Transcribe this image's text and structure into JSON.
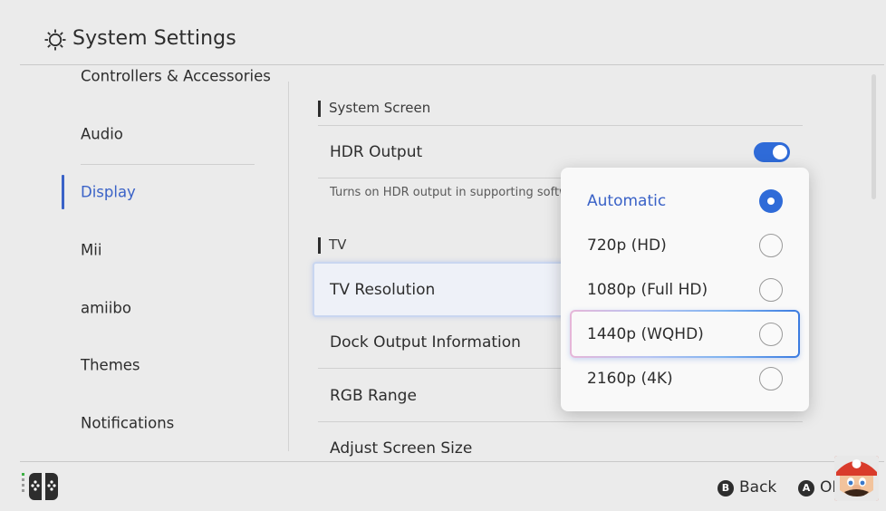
{
  "header": {
    "title": "System Settings",
    "icon": "gear-icon"
  },
  "sidebar": {
    "items": [
      {
        "label": "Controllers & Accessories"
      },
      {
        "label": "Audio"
      },
      {
        "label": "Display",
        "active": true
      },
      {
        "label": "Mii"
      },
      {
        "label": "amiibo"
      },
      {
        "label": "Themes"
      },
      {
        "label": "Notifications"
      }
    ]
  },
  "main": {
    "section_system_screen": "System Screen",
    "hdr_label": "HDR Output",
    "hdr_enabled": true,
    "hdr_desc": "Turns on HDR output in supporting software",
    "section_tv": "TV",
    "tv_resolution": "TV Resolution",
    "dock_output": "Dock Output Information",
    "rgb_range": "RGB Range",
    "adjust_screen": "Adjust Screen Size"
  },
  "popup": {
    "options": [
      {
        "label": "Automatic",
        "selected": true
      },
      {
        "label": "720p (HD)"
      },
      {
        "label": "1080p (Full HD)"
      },
      {
        "label": "1440p (WQHD)",
        "focused": true
      },
      {
        "label": "2160p (4K)"
      }
    ]
  },
  "footer": {
    "back_button": "B",
    "back_label": "Back",
    "ok_button": "A",
    "ok_label": "OK"
  },
  "colors": {
    "accent": "#2f6bd8",
    "active_text": "#3a62c7",
    "background": "#ebebeb"
  }
}
